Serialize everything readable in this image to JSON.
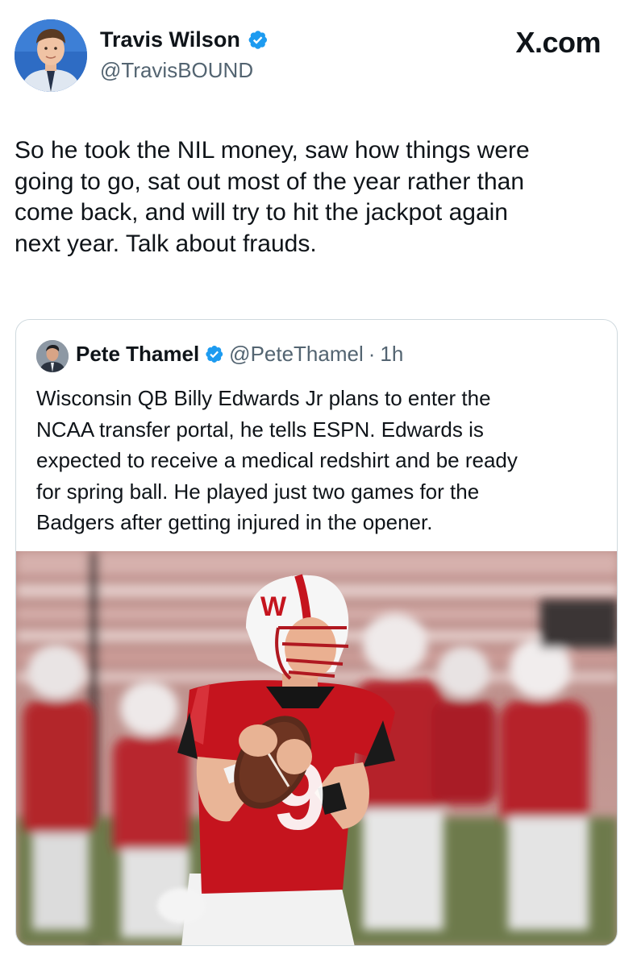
{
  "author": {
    "name": "Travis Wilson",
    "handle": "@TravisBOUND",
    "verified": true
  },
  "brand": "X.com",
  "tweet": {
    "lines": [
      "So he took the NIL money, saw how things were",
      "going to go, sat out most of the year rather than",
      "come back, and will try to hit the jackpot again",
      "next year. Talk about frauds."
    ]
  },
  "quote": {
    "name": "Pete Thamel",
    "handle": "@PeteThamel",
    "separator": "·",
    "time": "1h",
    "verified": true,
    "lines": [
      "Wisconsin QB Billy Edwards Jr plans to enter the",
      "NCAA transfer portal, he tells ESPN. Edwards is",
      "expected to receive a medical redshirt and be ready",
      "for spring ball. He played just two games for the",
      "Badgers after getting injured in the opener."
    ],
    "photo": {
      "jersey_number": "9"
    }
  },
  "colors": {
    "verified": "#1d9bf0",
    "text": "#0f1419",
    "secondary": "#536471",
    "border": "#cfd9de",
    "wisconsin_red": "#c5050c"
  }
}
